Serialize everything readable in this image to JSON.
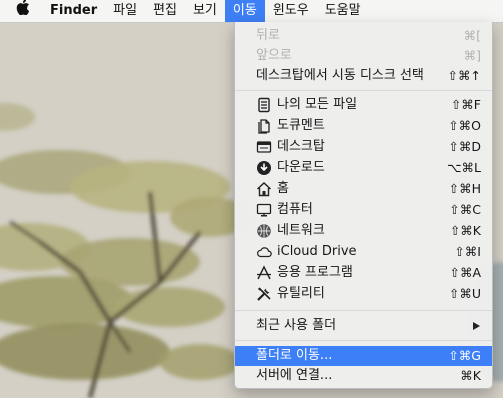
{
  "menubar": {
    "apple_icon": "apple-logo-icon",
    "app_name": "Finder",
    "menus": [
      "파일",
      "편집",
      "보기",
      "이동",
      "윈도우",
      "도움말"
    ],
    "active_menu": "이동"
  },
  "go_menu": {
    "back": {
      "label": "뒤로",
      "shortcut": "⌘["
    },
    "forward": {
      "label": "앞으로",
      "shortcut": "⌘]"
    },
    "startup_disk": {
      "label": "데스크탑에서 시동 디스크 선택",
      "shortcut": "⇧⌘↑"
    },
    "locations": [
      {
        "label": "나의 모든 파일",
        "shortcut": "⇧⌘F",
        "icon": "all-files-icon"
      },
      {
        "label": "도큐멘트",
        "shortcut": "⇧⌘O",
        "icon": "documents-icon"
      },
      {
        "label": "데스크탑",
        "shortcut": "⇧⌘D",
        "icon": "desktop-icon"
      },
      {
        "label": "다운로드",
        "shortcut": "⌥⌘L",
        "icon": "downloads-icon"
      },
      {
        "label": "홈",
        "shortcut": "⇧⌘H",
        "icon": "home-icon"
      },
      {
        "label": "컴퓨터",
        "shortcut": "⇧⌘C",
        "icon": "computer-icon"
      },
      {
        "label": "네트워크",
        "shortcut": "⇧⌘K",
        "icon": "network-icon"
      },
      {
        "label": "iCloud Drive",
        "shortcut": "⇧⌘I",
        "icon": "icloud-icon"
      },
      {
        "label": "응용 프로그램",
        "shortcut": "⇧⌘A",
        "icon": "applications-icon"
      },
      {
        "label": "유틸리티",
        "shortcut": "⇧⌘U",
        "icon": "utilities-icon"
      }
    ],
    "recent_folders": {
      "label": "최근 사용 폴더"
    },
    "go_to_folder": {
      "label": "폴더로 이동...",
      "shortcut": "⇧⌘G"
    },
    "connect_server": {
      "label": "서버에 연결...",
      "shortcut": "⌘K"
    }
  },
  "colors": {
    "highlight": "#3d7ff6",
    "menubar": "#f6f6f6"
  }
}
